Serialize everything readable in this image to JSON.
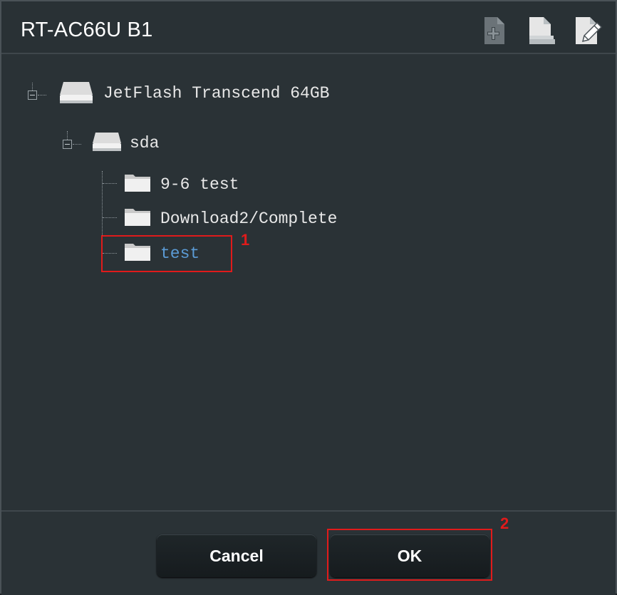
{
  "window": {
    "title": "RT-AC66U B1"
  },
  "toolbar": [
    {
      "icon": "add-folder-icon"
    },
    {
      "icon": "document-icon"
    },
    {
      "icon": "edit-icon"
    }
  ],
  "tree": {
    "root": {
      "label": "JetFlash Transcend 64GB",
      "icon": "drive-icon",
      "expanded": true
    },
    "partition": {
      "label": "sda",
      "icon": "drive-icon",
      "expanded": true
    },
    "folders": [
      {
        "label": "9-6 test",
        "icon": "folder-icon"
      },
      {
        "label": "Download2/Complete",
        "icon": "folder-icon"
      },
      {
        "label": "test",
        "icon": "folder-icon",
        "selected": true
      }
    ]
  },
  "annotations": {
    "step1": "1",
    "step2": "2"
  },
  "footer": {
    "cancel_label": "Cancel",
    "ok_label": "OK"
  },
  "colors": {
    "background": "#2a3236",
    "selected_text": "#5b9bd5",
    "annotation": "#e01b1b"
  }
}
